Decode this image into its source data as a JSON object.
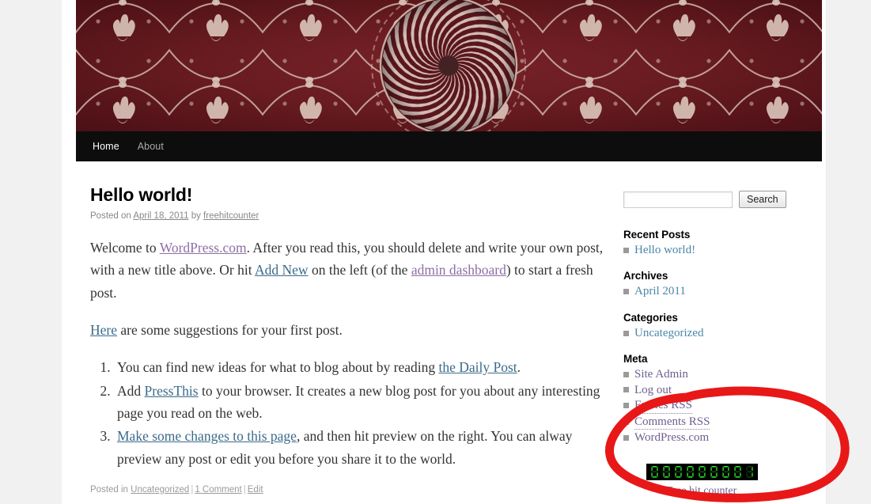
{
  "site": {
    "background_color": "#f1f1f1",
    "banner_color": "#5e1319",
    "banner_alt": "dark red batik textile header with spiral medallion"
  },
  "nav": {
    "items": [
      {
        "label": "Home",
        "active": true
      },
      {
        "label": "About",
        "active": false
      }
    ]
  },
  "post": {
    "title": "Hello world!",
    "meta_posted_on": "Posted on",
    "meta_date": "April 18, 2011",
    "meta_by": "by",
    "meta_author": "freehitcounter",
    "p1_a": "Welcome to ",
    "p1_link1": "WordPress.com",
    "p1_b": ". After you read this, you should delete and write your own post, with a new title above. Or hit ",
    "p1_link2": "Add New",
    "p1_c": " on the left (of the ",
    "p1_link3": "admin dashboard",
    "p1_d": ") to start a fresh post.",
    "p2_link": "Here",
    "p2_text": " are some suggestions for your first post.",
    "list": [
      {
        "a": "You can find new ideas for what to blog about by reading ",
        "link": "the Daily Post",
        "b": "."
      },
      {
        "a": "Add ",
        "link": "PressThis",
        "b": " to your browser. It creates a new blog post for you about any interesting page you read on the web."
      },
      {
        "a": "",
        "link": "Make some changes to this page",
        "b": ", and then hit preview on the right. You can alway preview any post or edit you before you share it to the world."
      }
    ],
    "footer_posted_in": "Posted in",
    "footer_category": "Uncategorized",
    "footer_comments": "1 Comment",
    "footer_edit": "Edit",
    "footer_separator": "|"
  },
  "sidebar": {
    "search": {
      "value": "",
      "placeholder": "",
      "button_label": "Search"
    },
    "widgets": [
      {
        "title": "Recent Posts",
        "items": [
          {
            "label": "Hello world!"
          }
        ]
      },
      {
        "title": "Archives",
        "items": [
          {
            "label": "April 2011"
          }
        ]
      },
      {
        "title": "Categories",
        "items": [
          {
            "label": "Uncategorized"
          }
        ]
      },
      {
        "title": "Meta",
        "items": [
          {
            "label": "Site Admin"
          },
          {
            "label": "Log out"
          },
          {
            "label": "Entries RSS"
          },
          {
            "label": "Comments RSS"
          },
          {
            "label": "WordPress.com"
          }
        ]
      }
    ],
    "counter": {
      "digits": [
        "0",
        "0",
        "0",
        "0",
        "0",
        "0",
        "0",
        "0",
        "1"
      ],
      "label": "Free hit counter",
      "on_color": "#2fe02f",
      "off_color": "#0d3d0d",
      "background_color": "#000000"
    }
  },
  "annotation": {
    "shape": "hand-drawn red oval",
    "color": "#e81818",
    "encircles": "Free hit counter widget"
  }
}
